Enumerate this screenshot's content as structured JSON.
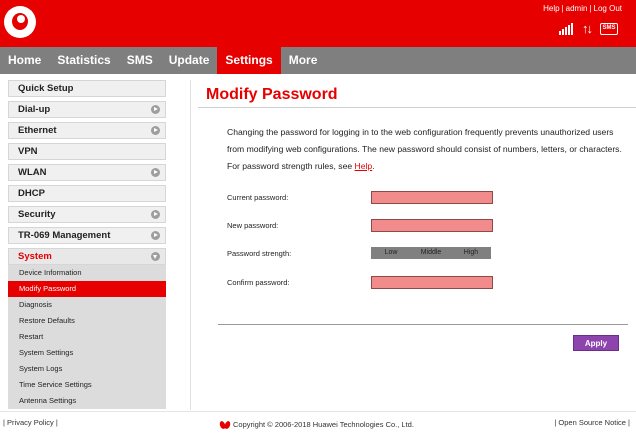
{
  "header": {
    "help": "Help",
    "user": "admin",
    "logout": "Log Out",
    "icons": [
      "signal-icon",
      "data-arrows-icon",
      "message-icon"
    ]
  },
  "nav": [
    "Home",
    "Statistics",
    "SMS",
    "Update",
    "Settings",
    "More"
  ],
  "sidebar": {
    "items": [
      {
        "label": "Quick Setup",
        "arrow": false
      },
      {
        "label": "Dial-up",
        "arrow": true
      },
      {
        "label": "Ethernet",
        "arrow": true
      },
      {
        "label": "VPN",
        "arrow": false
      },
      {
        "label": "WLAN",
        "arrow": true
      },
      {
        "label": "DHCP",
        "arrow": false
      },
      {
        "label": "Security",
        "arrow": true
      },
      {
        "label": "TR-069 Management",
        "arrow": true
      },
      {
        "label": "System",
        "arrow": true
      }
    ],
    "submenu": [
      "Device Information",
      "Modify Password",
      "Diagnosis",
      "Restore Defaults",
      "Restart",
      "System Settings",
      "System Logs",
      "Time Service Settings",
      "Antenna Settings"
    ]
  },
  "main": {
    "title": "Modify Password",
    "desc_text": "Changing the password for logging in to the web configuration frequently prevents unauthorized users from modifying web configurations. The new password should consist of numbers, letters, or characters. For password strength rules, see ",
    "desc_link": "Help",
    "desc_end": ".",
    "labels": {
      "current": "Current password:",
      "new": "New password:",
      "strength": "Password strength:",
      "confirm": "Confirm password:"
    },
    "strength_levels": [
      "Low",
      "Middle",
      "High"
    ],
    "apply": "Apply"
  },
  "footer": {
    "privacy": "Privacy Policy",
    "copyright": "Copyright © 2006-2018 Huawei Technologies Co., Ltd.",
    "open_source": "Open Source Notice"
  },
  "colors": {
    "brand": "#e60000",
    "nav": "#7f7f7f",
    "apply": "#8e44ad",
    "input": "#f28b8b"
  }
}
